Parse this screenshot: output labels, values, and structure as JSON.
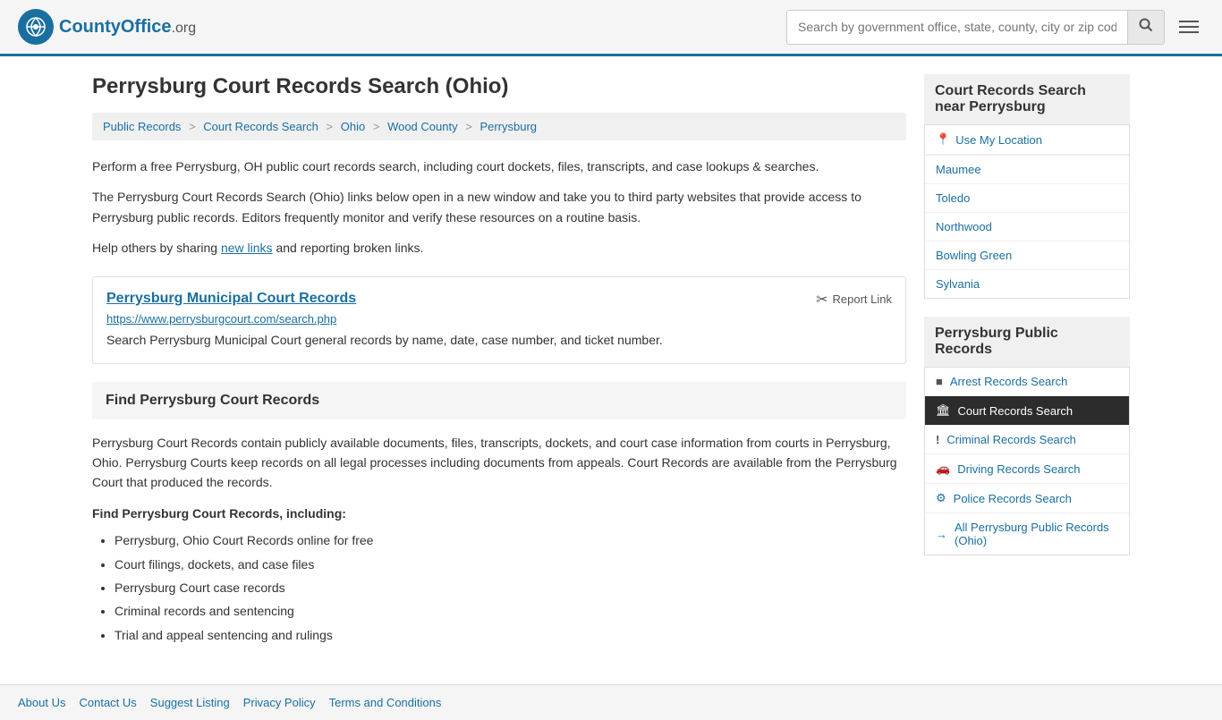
{
  "site": {
    "name": "CountyOffice",
    "domain": ".org",
    "search_placeholder": "Search by government office, state, county, city or zip code"
  },
  "page": {
    "title": "Perrysburg Court Records Search (Ohio)"
  },
  "breadcrumb": {
    "items": [
      {
        "label": "Public Records",
        "href": "#"
      },
      {
        "label": "Court Records Search",
        "href": "#"
      },
      {
        "label": "Ohio",
        "href": "#"
      },
      {
        "label": "Wood County",
        "href": "#"
      },
      {
        "label": "Perrysburg",
        "href": "#"
      }
    ]
  },
  "content": {
    "intro_1": "Perform a free Perrysburg, OH public court records search, including court dockets, files, transcripts, and case lookups & searches.",
    "intro_2": "The Perrysburg Court Records Search (Ohio) links below open in a new window and take you to third party websites that provide access to Perrysburg public records. Editors frequently monitor and verify these resources on a routine basis.",
    "intro_3": "Help others by sharing ",
    "new_links_label": "new links",
    "intro_3_end": " and reporting broken links.",
    "link_title": "Perrysburg Municipal Court Records",
    "link_url": "https://www.perrysburgcourt.com/search.php",
    "link_desc": "Search Perrysburg Municipal Court general records by name, date, case number, and ticket number.",
    "report_link_label": "Report Link",
    "find_section_title": "Find Perrysburg Court Records",
    "find_para": "Perrysburg Court Records contain publicly available documents, files, transcripts, dockets, and court case information from courts in Perrysburg, Ohio. Perrysburg Courts keep records on all legal processes including documents from appeals. Court Records are available from the Perrysburg Court that produced the records.",
    "find_subheading": "Find Perrysburg Court Records, including:",
    "find_list": [
      "Perrysburg, Ohio Court Records online for free",
      "Court filings, dockets, and case files",
      "Perrysburg Court case records",
      "Criminal records and sentencing",
      "Trial and appeal sentencing and rulings"
    ]
  },
  "sidebar": {
    "near_heading": "Court Records Search near Perrysburg",
    "near_items": [
      {
        "label": "Use My Location",
        "icon": "📍",
        "href": "#",
        "type": "location"
      },
      {
        "label": "Maumee",
        "href": "#"
      },
      {
        "label": "Toledo",
        "href": "#"
      },
      {
        "label": "Northwood",
        "href": "#"
      },
      {
        "label": "Bowling Green",
        "href": "#"
      },
      {
        "label": "Sylvania",
        "href": "#"
      }
    ],
    "public_records_heading": "Perrysburg Public Records",
    "public_records_items": [
      {
        "label": "Arrest Records Search",
        "icon": "■",
        "href": "#",
        "active": false
      },
      {
        "label": "Court Records Search",
        "icon": "🏛",
        "href": "#",
        "active": true
      },
      {
        "label": "Criminal Records Search",
        "icon": "!",
        "href": "#",
        "active": false
      },
      {
        "label": "Driving Records Search",
        "icon": "🚗",
        "href": "#",
        "active": false
      },
      {
        "label": "Police Records Search",
        "icon": "⚙",
        "href": "#",
        "active": false
      },
      {
        "label": "All Perrysburg Public Records (Ohio)",
        "icon": "→",
        "href": "#",
        "active": false
      }
    ]
  },
  "footer": {
    "links": [
      {
        "label": "About Us"
      },
      {
        "label": "Contact Us"
      },
      {
        "label": "Suggest Listing"
      },
      {
        "label": "Privacy Policy"
      },
      {
        "label": "Terms and Conditions"
      }
    ]
  }
}
